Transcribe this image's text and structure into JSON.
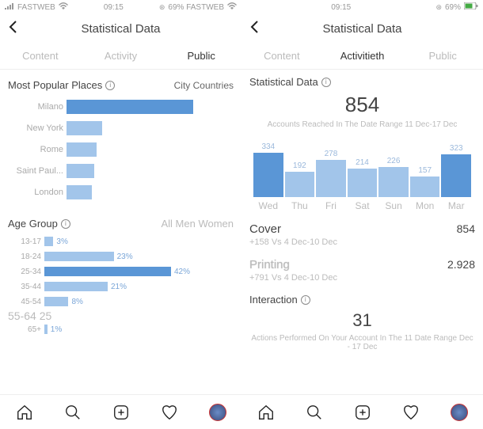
{
  "left": {
    "status": {
      "carrier": "FASTWEB",
      "time": "09:15",
      "battery": "69% FASTWEB"
    },
    "header": {
      "title": "Statistical Data"
    },
    "tabs": [
      "Content",
      "Activity",
      "Public"
    ],
    "active_tab": 2,
    "places": {
      "title": "Most Popular Places",
      "sub": "City Countries"
    },
    "age": {
      "title": "Age Group",
      "toggles": "All Men Women",
      "big": "55-64 25"
    }
  },
  "right": {
    "status": {
      "carrier": "",
      "time": "09:15",
      "battery": "69%"
    },
    "header": {
      "title": "Statistical Data"
    },
    "tabs": [
      "Content",
      "Activitieth",
      "Public"
    ],
    "active_tab": 1,
    "stat": {
      "title": "Statistical Data"
    },
    "reach": {
      "number": "854",
      "caption": "Accounts Reached In The Date Range 11 Dec-17 Dec"
    },
    "cover": {
      "name": "Cover",
      "val": "854",
      "sub": "+158 Vs 4 Dec-10 Dec"
    },
    "printing": {
      "name": "Printing",
      "val": "2.928",
      "sub": "+791 Vs 4 Dec-10 Dec"
    },
    "interaction": {
      "title": "Interaction",
      "number": "31",
      "caption": "Actions Performed On Your Account In The 11 Date Range Dec - 17 Dec"
    }
  },
  "chart_data": [
    {
      "type": "bar",
      "orientation": "horizontal",
      "title": "Most Popular Places",
      "categories": [
        "Milano",
        "New York",
        "Rome",
        "Saint Paul...",
        "London"
      ],
      "values": [
        100,
        28,
        24,
        22,
        20
      ],
      "highlight_index": 0
    },
    {
      "type": "bar",
      "orientation": "horizontal",
      "title": "Age Group",
      "categories": [
        "13-17",
        "18-24",
        "25-34",
        "35-44",
        "45-54",
        "65+"
      ],
      "values": [
        3,
        23,
        42,
        21,
        8,
        1
      ],
      "labels": [
        "3%",
        "23%",
        "42%",
        "21%",
        "8%",
        "1%"
      ],
      "highlight_index": 2
    },
    {
      "type": "bar",
      "orientation": "vertical",
      "title": "Accounts Reached",
      "categories": [
        "Wed",
        "Thu",
        "Fri",
        "Sat",
        "Sun",
        "Mon",
        "Mar"
      ],
      "values": [
        334,
        192,
        278,
        214,
        226,
        157,
        323
      ],
      "highlight_indices": [
        0,
        6
      ],
      "ylim": [
        0,
        334
      ]
    }
  ]
}
